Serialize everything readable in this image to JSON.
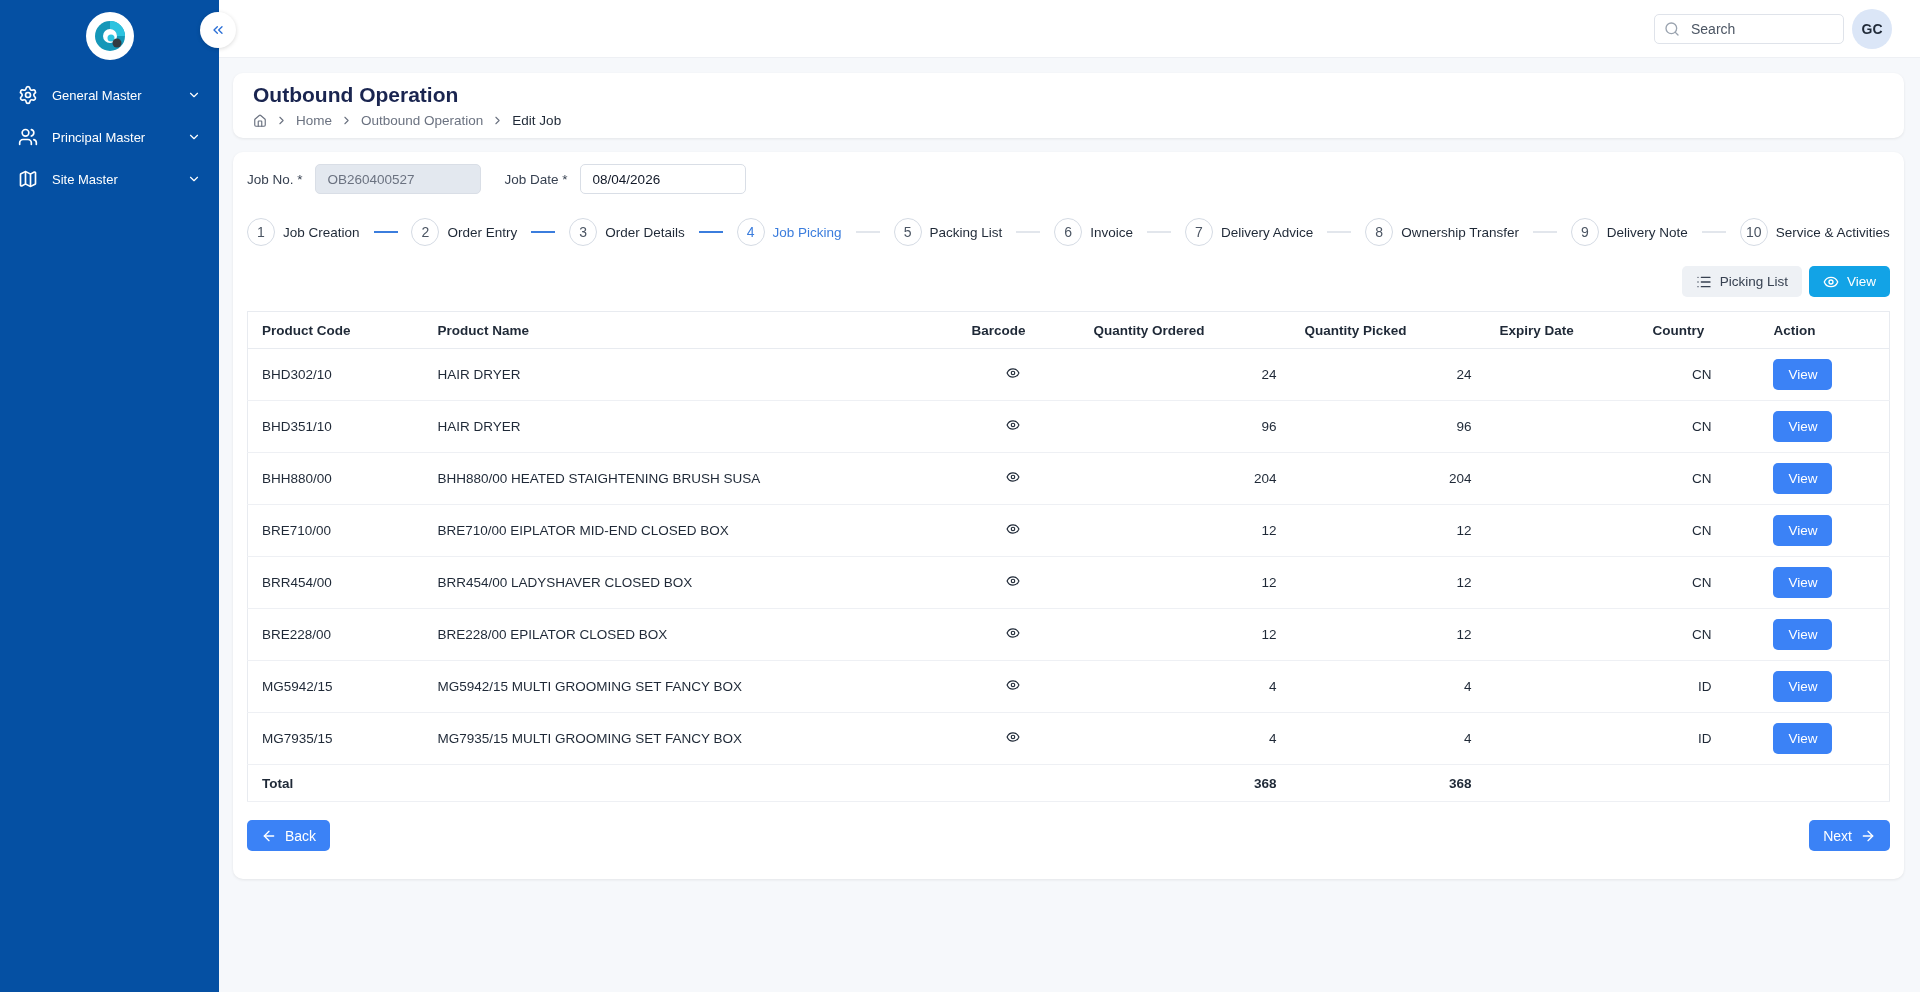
{
  "sidebar": {
    "items": [
      {
        "label": "General Master"
      },
      {
        "label": "Principal Master"
      },
      {
        "label": "Site Master"
      }
    ]
  },
  "topbar": {
    "search": {
      "placeholder": "Search"
    },
    "avatar": "GC"
  },
  "page": {
    "title": "Outbound Operation",
    "breadcrumb": [
      "Home",
      "Outbound Operation",
      "Edit Job"
    ]
  },
  "form": {
    "job_no": {
      "label": "Job No. *",
      "value": "OB260400527"
    },
    "job_date": {
      "label": "Job Date *",
      "value": "08/04/2026"
    }
  },
  "steps": [
    {
      "number": "1",
      "label": "Job Creation",
      "selected": false
    },
    {
      "number": "2",
      "label": "Order Entry",
      "selected": false
    },
    {
      "number": "3",
      "label": "Order Details",
      "selected": false
    },
    {
      "number": "4",
      "label": "Job Picking",
      "selected": true
    },
    {
      "number": "5",
      "label": "Packing List",
      "selected": false
    },
    {
      "number": "6",
      "label": "Invoice",
      "selected": false
    },
    {
      "number": "7",
      "label": "Delivery Advice",
      "selected": false
    },
    {
      "number": "8",
      "label": "Ownership Transfer",
      "selected": false
    },
    {
      "number": "9",
      "label": "Delivery Note",
      "selected": false
    },
    {
      "number": "10",
      "label": "Service & Activities",
      "selected": false
    }
  ],
  "actions": {
    "picking_list": "Picking List",
    "view": "View"
  },
  "table": {
    "columns": [
      "Product Code",
      "Product Name",
      "Barcode",
      "Quantity Ordered",
      "Quantity Picked",
      "Expiry Date",
      "Country",
      "Action"
    ],
    "rows": [
      {
        "code": "BHD302/10",
        "name": "HAIR DRYER",
        "ordered": "24",
        "picked": "24",
        "country": "CN",
        "action": "View"
      },
      {
        "code": "BHD351/10",
        "name": "HAIR DRYER",
        "ordered": "96",
        "picked": "96",
        "country": "CN",
        "action": "View"
      },
      {
        "code": "BHH880/00",
        "name": "BHH880/00 HEATED STAIGHTENING BRUSH SUSA",
        "ordered": "204",
        "picked": "204",
        "country": "CN",
        "action": "View"
      },
      {
        "code": "BRE710/00",
        "name": "BRE710/00 EIPLATOR MID-END CLOSED BOX",
        "ordered": "12",
        "picked": "12",
        "country": "CN",
        "action": "View"
      },
      {
        "code": "BRR454/00",
        "name": "BRR454/00 LADYSHAVER CLOSED BOX",
        "ordered": "12",
        "picked": "12",
        "country": "CN",
        "action": "View"
      },
      {
        "code": "BRE228/00",
        "name": "BRE228/00 EPILATOR CLOSED BOX",
        "ordered": "12",
        "picked": "12",
        "country": "CN",
        "action": "View"
      },
      {
        "code": "MG5942/15",
        "name": "MG5942/15 MULTI GROOMING SET FANCY BOX",
        "ordered": "4",
        "picked": "4",
        "country": "ID",
        "action": "View"
      },
      {
        "code": "MG7935/15",
        "name": "MG7935/15 MULTI GROOMING SET FANCY BOX",
        "ordered": "4",
        "picked": "4",
        "country": "ID",
        "action": "View"
      }
    ],
    "total": {
      "label": "Total",
      "ordered": "368",
      "picked": "368"
    }
  },
  "footer": {
    "back": "Back",
    "next": "Next"
  }
}
